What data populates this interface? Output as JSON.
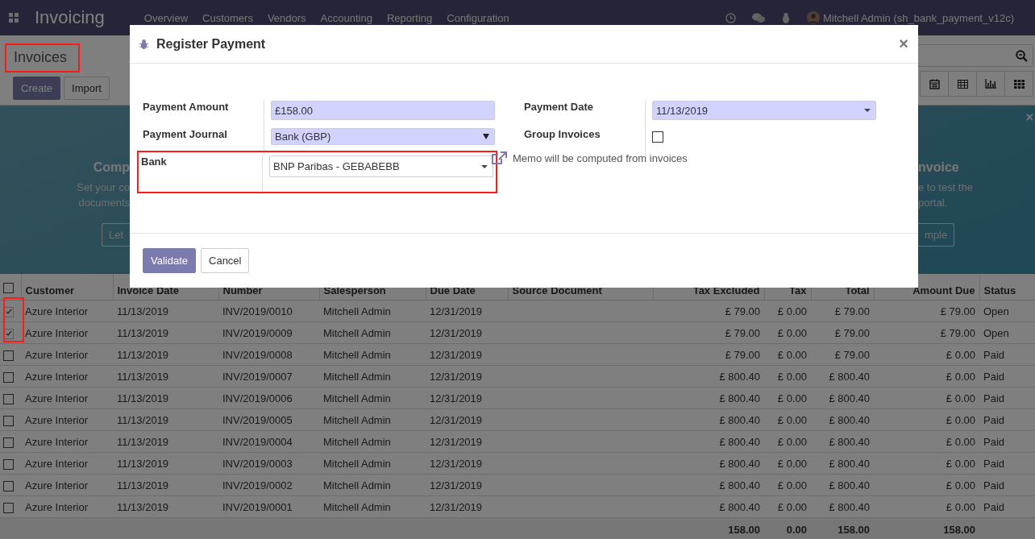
{
  "app_bar": {
    "brand": "Invoicing",
    "menu": [
      "Overview",
      "Customers",
      "Vendors",
      "Accounting",
      "Reporting",
      "Configuration"
    ],
    "user": "Mitchell Admin (sh_bank_payment_v12c)"
  },
  "control_panel": {
    "breadcrumb": {
      "text": "Invoices",
      "highlighted": true
    },
    "buttons": [
      "Create",
      "Import"
    ]
  },
  "banner": {
    "left": {
      "heading": "Comp",
      "lines": [
        "Set your co",
        "documents"
      ],
      "button": "Let"
    },
    "right": {
      "heading": "nvoice",
      "lines": [
        "e to test the",
        "portal."
      ],
      "button": "mple"
    },
    "close": "×"
  },
  "table": {
    "columns": [
      "Customer",
      "Invoice Date",
      "Number",
      "Salesperson",
      "Due Date",
      "Source Document",
      "Tax Excluded",
      "Tax",
      "Total",
      "Amount Due",
      "Status"
    ],
    "rows": [
      {
        "selected": true,
        "highlighted": true,
        "cells": [
          "Azure Interior",
          "11/13/2019",
          "INV/2019/0010",
          "Mitchell Admin",
          "12/31/2019",
          "",
          "£ 79.00",
          "£ 0.00",
          "£ 79.00",
          "£ 79.00",
          "Open"
        ]
      },
      {
        "selected": true,
        "highlighted": true,
        "cells": [
          "Azure Interior",
          "11/13/2019",
          "INV/2019/0009",
          "Mitchell Admin",
          "12/31/2019",
          "",
          "£ 79.00",
          "£ 0.00",
          "£ 79.00",
          "£ 79.00",
          "Open"
        ]
      },
      {
        "selected": false,
        "highlighted": false,
        "cells": [
          "Azure Interior",
          "11/13/2019",
          "INV/2019/0008",
          "Mitchell Admin",
          "12/31/2019",
          "",
          "£ 79.00",
          "£ 0.00",
          "£ 79.00",
          "£ 0.00",
          "Paid"
        ]
      },
      {
        "selected": false,
        "highlighted": false,
        "cells": [
          "Azure Interior",
          "11/13/2019",
          "INV/2019/0007",
          "Mitchell Admin",
          "12/31/2019",
          "",
          "£ 800.40",
          "£ 0.00",
          "£ 800.40",
          "£ 0.00",
          "Paid"
        ]
      },
      {
        "selected": false,
        "highlighted": false,
        "cells": [
          "Azure Interior",
          "11/13/2019",
          "INV/2019/0006",
          "Mitchell Admin",
          "12/31/2019",
          "",
          "£ 800.40",
          "£ 0.00",
          "£ 800.40",
          "£ 0.00",
          "Paid"
        ]
      },
      {
        "selected": false,
        "highlighted": false,
        "cells": [
          "Azure Interior",
          "11/13/2019",
          "INV/2019/0005",
          "Mitchell Admin",
          "12/31/2019",
          "",
          "£ 800.40",
          "£ 0.00",
          "£ 800.40",
          "£ 0.00",
          "Paid"
        ]
      },
      {
        "selected": false,
        "highlighted": false,
        "cells": [
          "Azure Interior",
          "11/13/2019",
          "INV/2019/0004",
          "Mitchell Admin",
          "12/31/2019",
          "",
          "£ 800.40",
          "£ 0.00",
          "£ 800.40",
          "£ 0.00",
          "Paid"
        ]
      },
      {
        "selected": false,
        "highlighted": false,
        "cells": [
          "Azure Interior",
          "11/13/2019",
          "INV/2019/0003",
          "Mitchell Admin",
          "12/31/2019",
          "",
          "£ 800.40",
          "£ 0.00",
          "£ 800.40",
          "£ 0.00",
          "Paid"
        ]
      },
      {
        "selected": false,
        "highlighted": false,
        "cells": [
          "Azure Interior",
          "11/13/2019",
          "INV/2019/0002",
          "Mitchell Admin",
          "12/31/2019",
          "",
          "£ 800.40",
          "£ 0.00",
          "£ 800.40",
          "£ 0.00",
          "Paid"
        ]
      },
      {
        "selected": false,
        "highlighted": false,
        "cells": [
          "Azure Interior",
          "11/13/2019",
          "INV/2019/0001",
          "Mitchell Admin",
          "12/31/2019",
          "",
          "£ 800.40",
          "£ 0.00",
          "£ 800.40",
          "£ 0.00",
          "Paid"
        ]
      }
    ],
    "all_selected": false,
    "totals": {
      "tax_excluded": "158.00",
      "tax": "0.00",
      "total": "158.00",
      "amount_due": "158.00"
    }
  },
  "dialog": {
    "title": "Register Payment",
    "close": "×",
    "left_fields": [
      {
        "label": "Payment Amount",
        "kind": "text",
        "value": "£158.00",
        "highlighted": false
      },
      {
        "label": "Payment Journal",
        "kind": "select",
        "value": "Bank (GBP)",
        "highlighted": false
      },
      {
        "label": "Bank",
        "kind": "dropdown",
        "value": "BNP Paribas - GEBABEBB",
        "highlighted": true
      }
    ],
    "right_fields": [
      {
        "label": "Payment Date",
        "kind": "date",
        "value": "11/13/2019"
      },
      {
        "label": "Group Invoices",
        "kind": "checkbox",
        "checked": false
      }
    ],
    "memo": "Memo will be computed from invoices",
    "buttons": [
      {
        "label": "Validate",
        "kind": "primary"
      },
      {
        "label": "Cancel",
        "kind": "secondary"
      }
    ]
  }
}
